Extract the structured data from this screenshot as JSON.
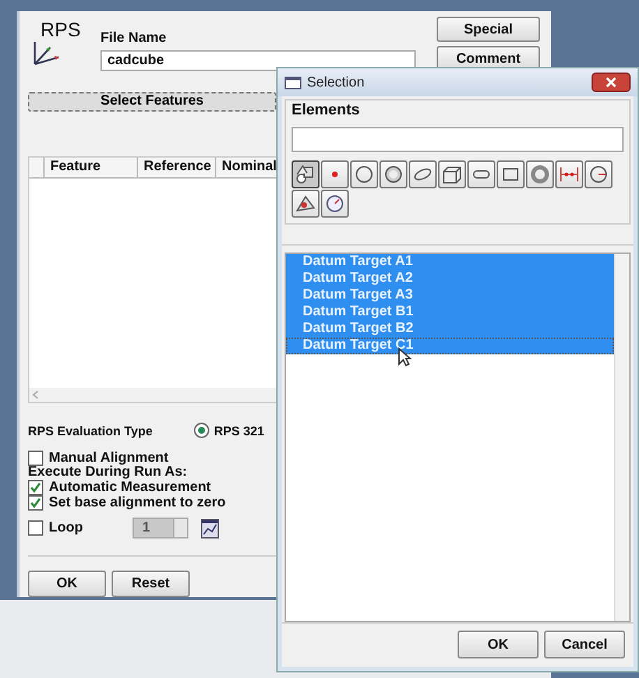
{
  "main_dialog": {
    "logo": "RPS",
    "file_name_label": "File Name",
    "file_name": "cadcube",
    "buttons": [
      "Special",
      "Comment"
    ],
    "select_features": "Select Features",
    "table": {
      "columns": [
        "Feature",
        "Reference",
        "Nominal"
      ]
    },
    "evaluation_type_label": "RPS Evaluation Type",
    "evaluation_option": {
      "label": "RPS 321",
      "selected": true
    },
    "manual_alignment": {
      "label": "Manual Alignment",
      "checked": false
    },
    "execute_label": "Execute During Run As:",
    "options": [
      {
        "label": "Automatic Measurement",
        "checked": true
      },
      {
        "label": "Set base alignment to zero",
        "checked": true
      }
    ],
    "loop": {
      "label": "Loop",
      "checked": false,
      "count": "1"
    },
    "footer_buttons": [
      "OK",
      "Reset"
    ]
  },
  "selection_dialog": {
    "title": "Selection",
    "group_label": "Elements",
    "tools": [
      {
        "kind": "select",
        "selected": true
      },
      {
        "kind": "point",
        "selected": false
      },
      {
        "kind": "circle",
        "selected": false
      },
      {
        "kind": "sphere",
        "selected": false
      },
      {
        "kind": "ellipse",
        "selected": false
      },
      {
        "kind": "box",
        "selected": false
      },
      {
        "kind": "slot",
        "selected": false
      },
      {
        "kind": "rectangle",
        "selected": false
      },
      {
        "kind": "ring",
        "selected": false
      },
      {
        "kind": "distance",
        "selected": false
      },
      {
        "kind": "circle-line",
        "selected": false
      },
      {
        "kind": "plane",
        "selected": false
      },
      {
        "kind": "gauge",
        "selected": false
      }
    ],
    "items": [
      {
        "label": "Datum Target A1",
        "selected": true
      },
      {
        "label": "Datum Target A2",
        "selected": true
      },
      {
        "label": "Datum Target A3",
        "selected": true
      },
      {
        "label": "Datum Target B1",
        "selected": true
      },
      {
        "label": "Datum Target B2",
        "selected": true
      },
      {
        "label": "Datum Target C1",
        "selected": true
      }
    ],
    "buttons": [
      "OK",
      "Cancel"
    ]
  }
}
